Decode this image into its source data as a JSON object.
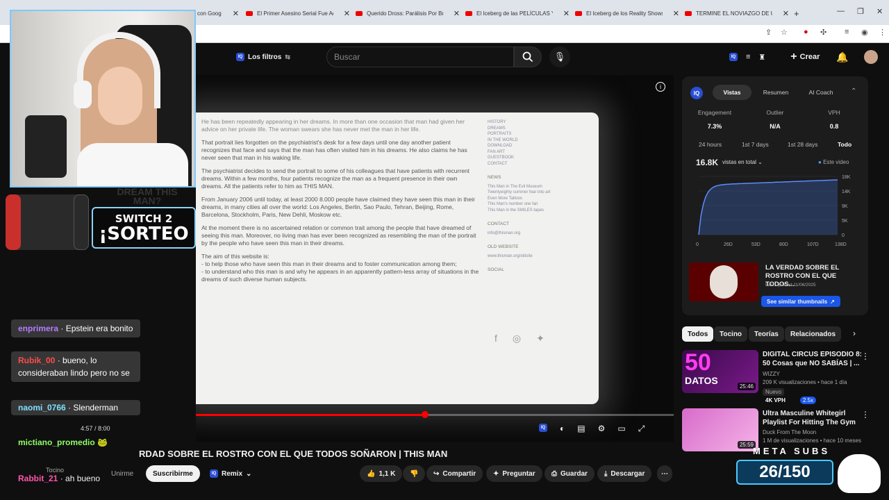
{
  "browser": {
    "tabs": [
      {
        "label": "con Goog"
      },
      {
        "label": "El Primer Asesino Serial Fue Ad"
      },
      {
        "label": "Querido Dross: Parálisis Por Bru"
      },
      {
        "label": "El Iceberg de las PELÍCULAS Y"
      },
      {
        "label": "El Iceberg de los Reality Shows"
      },
      {
        "label": "TERMINE EL NOVIAZGO DE UN"
      }
    ],
    "new_tab": "+",
    "close": "✕"
  },
  "header": {
    "filters_label": "Los filtros",
    "search_placeholder": "Buscar",
    "create_label": "Crear",
    "iq": "IQ"
  },
  "video": {
    "doc_paragraphs": [
      "He has been repeatedly appearing in her dreams. In more than one occasion that man had given her advice on her private life. The woman swears she has never met the man in her life.",
      "That portrait lies forgotten on the psychiatrist's desk for a few days until one day another patient recognizes that face and says that the man has often visited him in his dreams. He also claims he has never seen that man in his waking life.",
      "The psychiatrist decides to send the portrait to some of his colleagues that have patients with recurrent dreams. Within a few months, four patients recognize the man as a frequent presence in their own dreams. All the patients refer to him as THIS MAN.",
      "From January 2006 until today, at least 2000 8.000 people have claimed they have seen this man in their dreams, in many cities all over the world: Los Angeles, Berlin, Sao Paulo, Tehran, Beijing, Rome, Barcelona, Stockholm, Paris, New Dehli, Moskow etc.",
      "At the moment there is no ascertained relation or common trait among the people that have dreamed of seeing this man. Moreover, no living man has ever been recognized as resembling the man of the portrait by the people who have seen this man in their dreams.",
      "The aim of this website is:\n- to help those who have seen this man in their dreams and to foster communication among them;\n- to understand who this man is and why he appears in an apparently pattern-less array of situations in the dreams of such diverse human subjects."
    ],
    "doc_side_links": [
      "HISTORY",
      "DREAMS",
      "PORTRAITS",
      "IN THE WORLD",
      "DOWNLOAD",
      "FAN ART",
      "GUESTBOOK",
      "CONTACT"
    ],
    "news_head": "NEWS",
    "news_links": [
      "This Man in The Evil Museum",
      "Twentyeighty summer fear into art",
      "Even More Tattoos",
      "This Man's number one fan",
      "This Man in the SMILES tapes"
    ],
    "contact_head": "CONTACT",
    "contact_email": "info@thisman.org",
    "old_head": "OLD WEBSITE",
    "old_link": "www.thisman.org/oldsite",
    "social_head": "SOCIAL",
    "time": "4:57 / 8:00",
    "progress": 0.48,
    "title": "RDAD SOBRE EL ROSTRO CON EL QUE TODOS SOÑARON | THIS MAN"
  },
  "actions": {
    "join": "Unirme",
    "subscribe": "Suscribirme",
    "remix": "Remix",
    "likes": "1,1 K",
    "share": "Compartir",
    "ask": "Preguntar",
    "save": "Guardar",
    "download": "Descargar",
    "more": "⋯"
  },
  "stream_overlay": {
    "switch_line1": "SWITCH 2",
    "switch_line2": "¡SORTEO",
    "dream_text": "DREAM THIS MAN?",
    "chat": [
      {
        "user": "enprimera",
        "color": "#b57cff",
        "text": "Epstein era bonito"
      },
      {
        "user": "Rubik_00",
        "color": "#ff4b4b",
        "text": "bueno, lo consideraban lindo pero no se"
      },
      {
        "user": "naomi_0766",
        "color": "#7fe0ff",
        "text": "Slenderman"
      },
      {
        "user": "mictiano_promedio",
        "color": "#8cff66",
        "text": ""
      },
      {
        "user": "Rabbit_21",
        "color": "#ff55aa",
        "text": "ah bueno"
      }
    ],
    "channel_name": "Tocino",
    "subs_label": "META SUBS",
    "subs_count": "26/150"
  },
  "panel": {
    "tabs": [
      "Vistas",
      "Resumen",
      "AI Coach"
    ],
    "stats": [
      {
        "label": "Engagement",
        "value": "7.3%"
      },
      {
        "label": "Outlier",
        "value": "N/A"
      },
      {
        "label": "VPH",
        "value": "0.8"
      }
    ],
    "ranges": [
      "24 hours",
      "1st 7 days",
      "1st 28 days",
      "Todo"
    ],
    "views": "16.8K",
    "views_mode": "vistas en total",
    "this_video": "Este video",
    "y_ticks": [
      "18K",
      "14K",
      "9K",
      "5K",
      "0"
    ],
    "x_ticks": [
      "0",
      "26D",
      "53D",
      "80D",
      "107D",
      "138D"
    ],
    "thumb_title": "LA VERDAD SOBRE EL ROSTRO CON EL QUE TODOS...",
    "thumb_updated": "Last Updated 11/06/2025",
    "similar_btn": "See similar thumbnails"
  },
  "chips": [
    "Todos",
    "Tocino",
    "Teorías",
    "Relacionados"
  ],
  "recommendations": [
    {
      "title": "DIGITAL CIRCUS EPISODIO 8: 50 Cosas que NO SABÍAS | ...",
      "channel": "WIZZY",
      "meta": "209 K visualizaciones • hace 1 día",
      "badge": "Nuevo",
      "vph": "4K VPH",
      "outlier": "2.5x",
      "duration": "25:46",
      "thumb_text1": "50",
      "thumb_text2": "DATOS"
    },
    {
      "title": "Ultra Masculine Whitegirl Playlist For Hitting The Gym",
      "channel": "Duck From The Moon",
      "meta": "1 M de visualizaciones • hace 10 meses",
      "duration": "25:59"
    }
  ]
}
